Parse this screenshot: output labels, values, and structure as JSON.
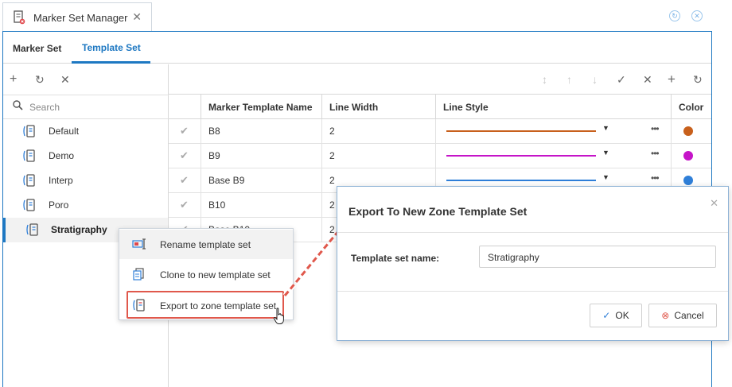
{
  "window": {
    "title": "Marker Set Manager",
    "close": "✕"
  },
  "tabs": [
    "Marker Set",
    "Template Set"
  ],
  "left": {
    "search_placeholder": "Search",
    "items": [
      "Default",
      "Demo",
      "Interp",
      "Poro",
      "Stratigraphy"
    ],
    "selected": "Stratigraphy"
  },
  "grid": {
    "headers": [
      "Marker Template Name",
      "Line Width",
      "Line Style",
      "Color"
    ],
    "rows": [
      {
        "name": "B8",
        "width": "2",
        "color": "#c8601c"
      },
      {
        "name": "B9",
        "width": "2",
        "color": "#c514c8"
      },
      {
        "name": "Base B9",
        "width": "2",
        "color": "#2f7fd8"
      },
      {
        "name": "B10",
        "width": "2",
        "color": ""
      },
      {
        "name": "Base B10",
        "width": "2",
        "color": ""
      }
    ]
  },
  "context_menu": {
    "items": [
      "Rename template set",
      "Clone to new template set",
      "Export to zone template set"
    ]
  },
  "dialog": {
    "title": "Export To New Zone Template Set",
    "field_label": "Template set name:",
    "field_value": "Stratigraphy",
    "ok": "OK",
    "cancel": "Cancel"
  },
  "accent": "#1e78c2",
  "highlight": "#e0584c"
}
